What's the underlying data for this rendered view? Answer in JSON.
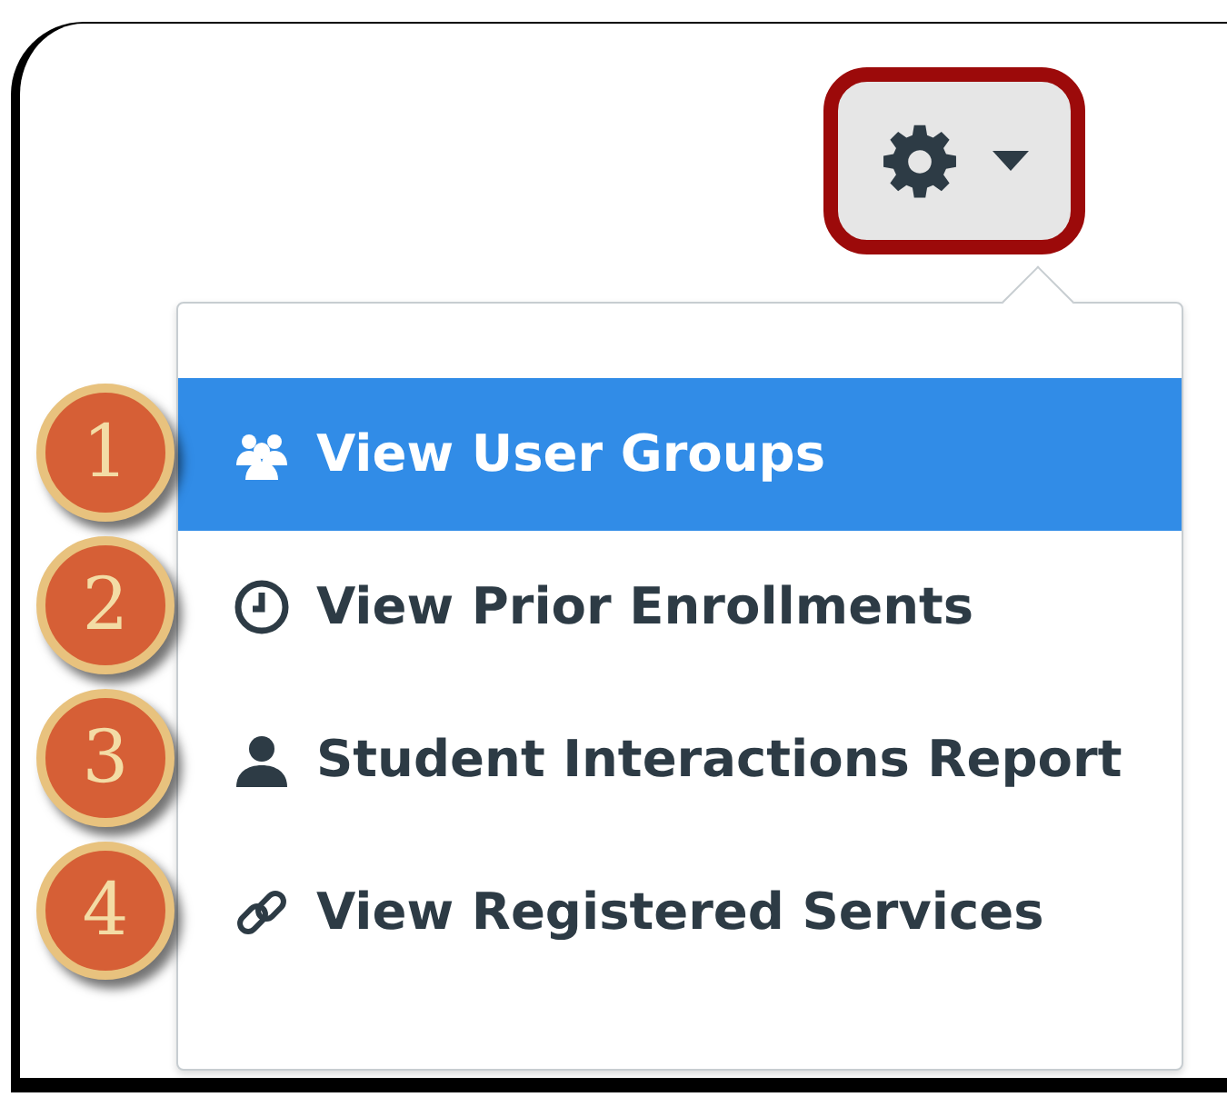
{
  "settings_button": {
    "highlighted": true
  },
  "menu_items": [
    {
      "label": "View User Groups",
      "selected": true,
      "callout": "1"
    },
    {
      "label": "View Prior Enrollments",
      "selected": false,
      "callout": "2"
    },
    {
      "label": "Student Interactions Report",
      "selected": false,
      "callout": "3"
    },
    {
      "label": "View Registered Services",
      "selected": false,
      "callout": "4"
    }
  ]
}
